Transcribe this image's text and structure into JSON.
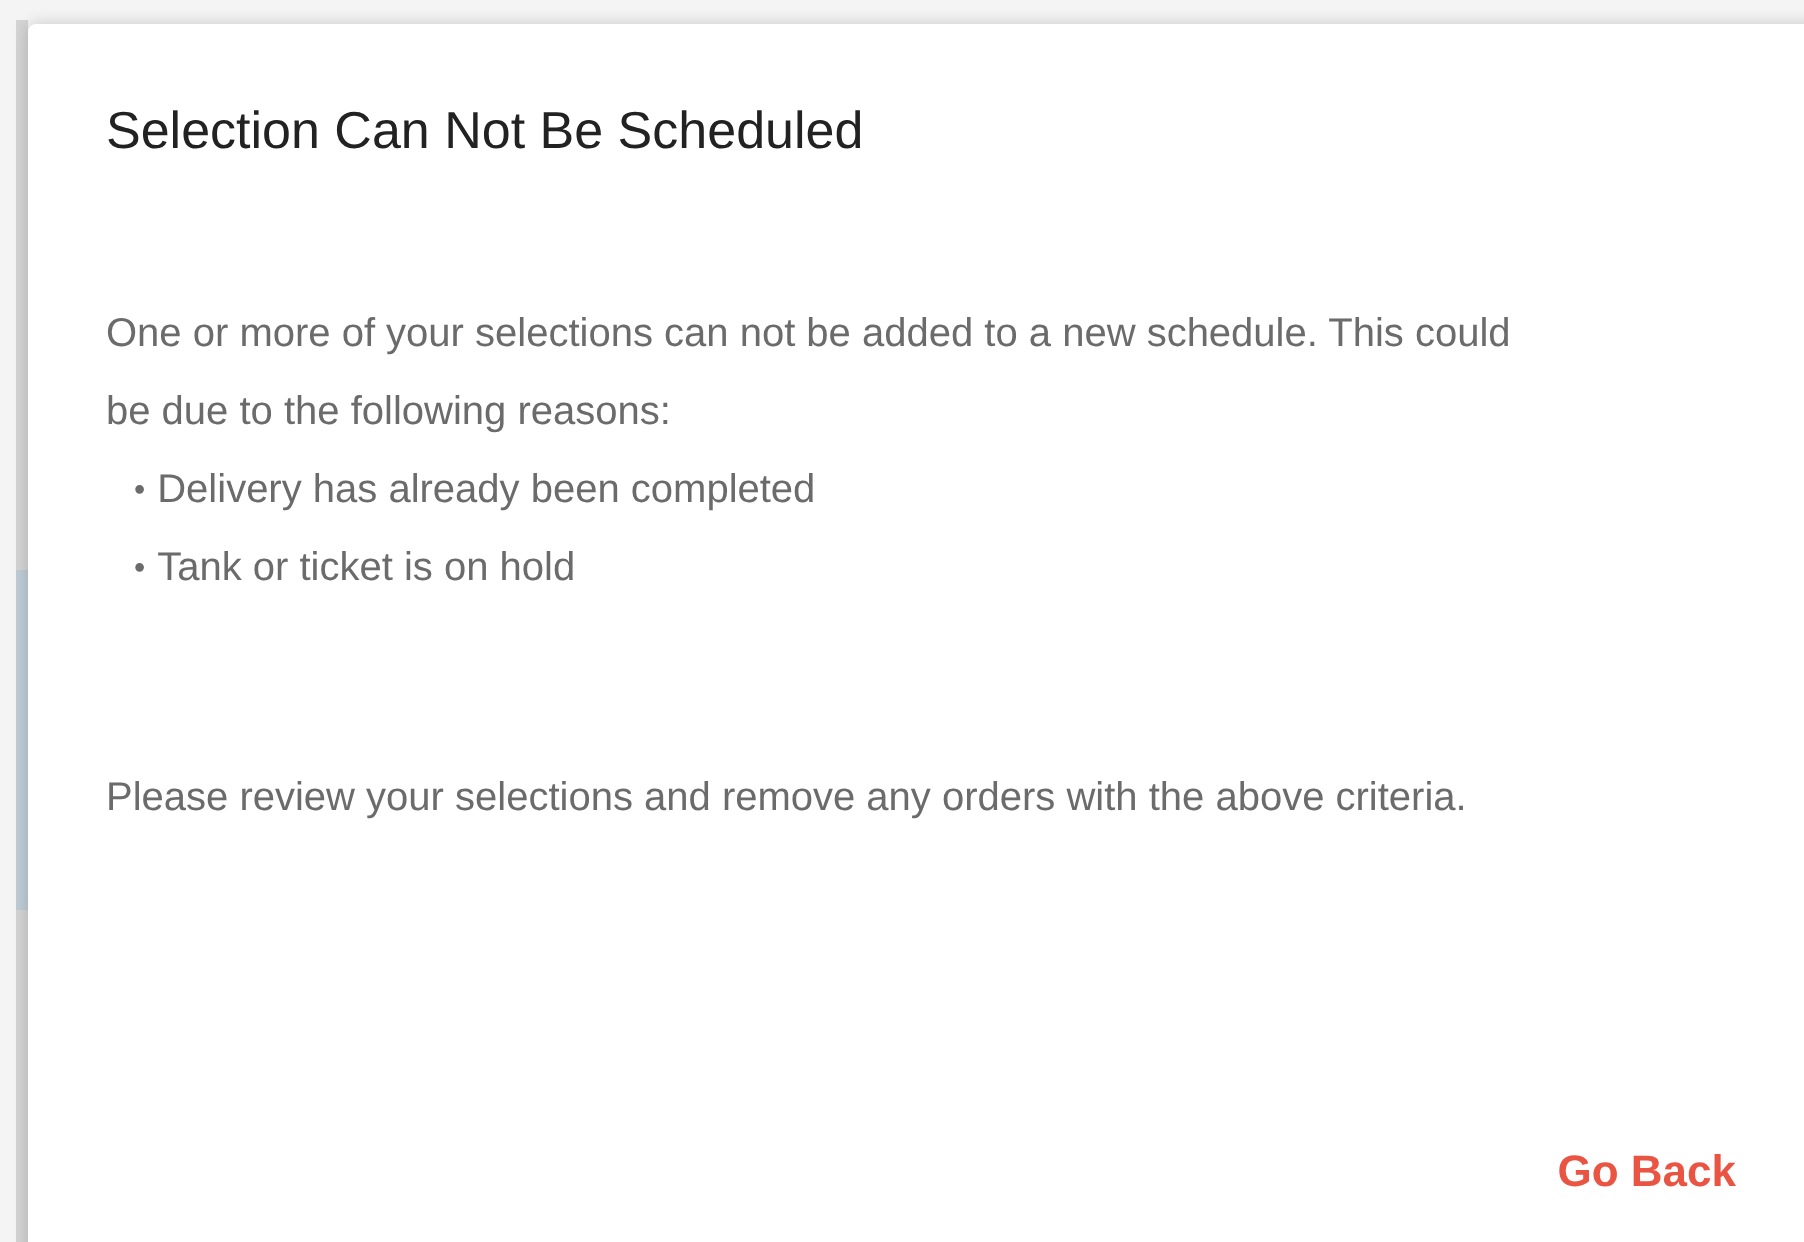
{
  "dialog": {
    "title": "Selection Can Not Be Scheduled",
    "intro": "One or more of your selections can not be added to a new schedule. This could be due to the following reasons:",
    "reasons": [
      {
        "bullet": "•",
        "text": "Delivery has already been completed"
      },
      {
        "bullet": "•",
        "text": "Tank or ticket is on hold"
      }
    ],
    "note": "Please review your selections and remove any orders with the above criteria.",
    "buttons": [
      "Go Back"
    ]
  }
}
